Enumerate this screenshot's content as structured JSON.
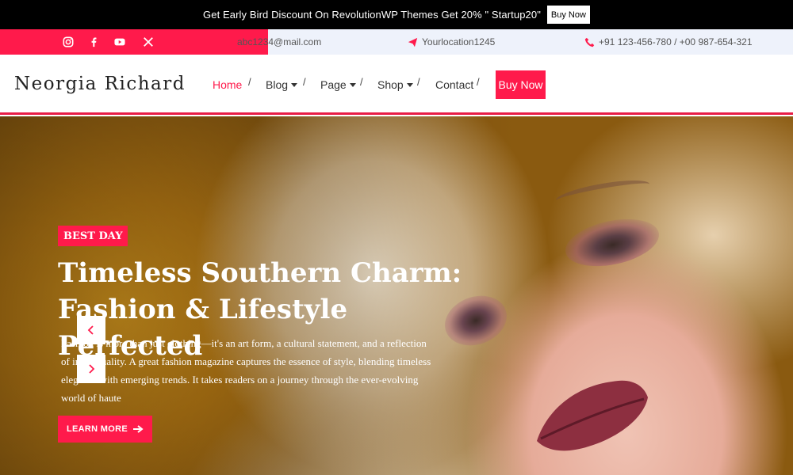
{
  "promo": {
    "text": "Get Early Bird Discount On RevolutionWP Themes Get 20% \" Startup20\"",
    "button": "Buy Now"
  },
  "contact": {
    "email": "abc1234@mail.com",
    "location": "Yourlocation1245",
    "phone": "+91 123-456-780 / +00 987-654-321",
    "social_icons": [
      "instagram-icon",
      "facebook-icon",
      "youtube-icon",
      "x-icon"
    ]
  },
  "header": {
    "logo": "Neorgia Richard",
    "nav": [
      {
        "label": "Home",
        "dropdown": false,
        "active": true
      },
      {
        "label": "Blog",
        "dropdown": true
      },
      {
        "label": "Page",
        "dropdown": true
      },
      {
        "label": "Shop",
        "dropdown": true
      },
      {
        "label": "Contact",
        "dropdown": false
      }
    ],
    "separator": "/",
    "cta": "Buy Now"
  },
  "hero": {
    "badge": "BEST DAY",
    "title_line1": "Timeless Southern Charm:",
    "title_line2": "Fashion & Lifestyle Perfected",
    "description": "Fashion is more than just clothing—it's an art form, a cultural statement, and a reflection of individuality. A great fashion magazine captures the essence of style, blending timeless elegance with emerging trends. It takes readers on a journey through the ever-evolving world of haute",
    "button": "LEARN MORE"
  },
  "colors": {
    "accent": "#ff1a4b",
    "promo_bg": "#000000",
    "contact_bg": "#eef2fb"
  }
}
